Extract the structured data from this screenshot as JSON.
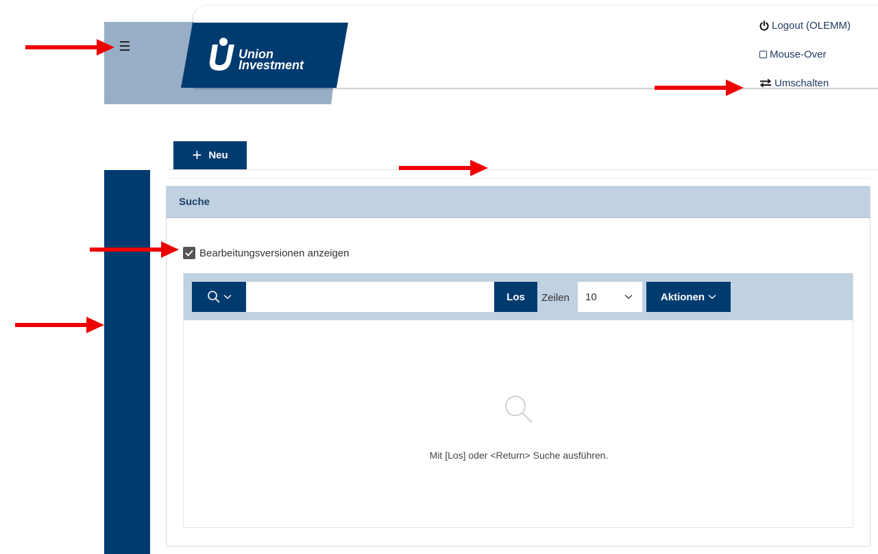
{
  "header": {
    "logo": {
      "line1": "Union",
      "line2": "Investment"
    },
    "menu_icon": "hamburger-icon",
    "links": [
      {
        "label": "Logout (OLEMM)",
        "icon": "power-icon"
      },
      {
        "label": "Mouse-Over",
        "icon": "checkbox-icon"
      },
      {
        "label": "Umschalten",
        "icon": "switch-arrows-icon"
      }
    ]
  },
  "toolbar": {
    "new_label": "Neu"
  },
  "search_panel": {
    "title": "Suche",
    "show_versions_label": "Bearbeitungsversionen anzeigen",
    "show_versions_checked": true,
    "search_placeholder": "",
    "go_label": "Los",
    "rows_label": "Zeilen",
    "rows_value": "10",
    "actions_label": "Aktionen",
    "empty_message": "Mit [Los] oder <Return> Suche ausführen."
  },
  "colors": {
    "primary": "#003b6f",
    "header_tab": "#97aec6",
    "panel_header": "#c0d1e1",
    "annotation_arrow": "#ee0000"
  }
}
